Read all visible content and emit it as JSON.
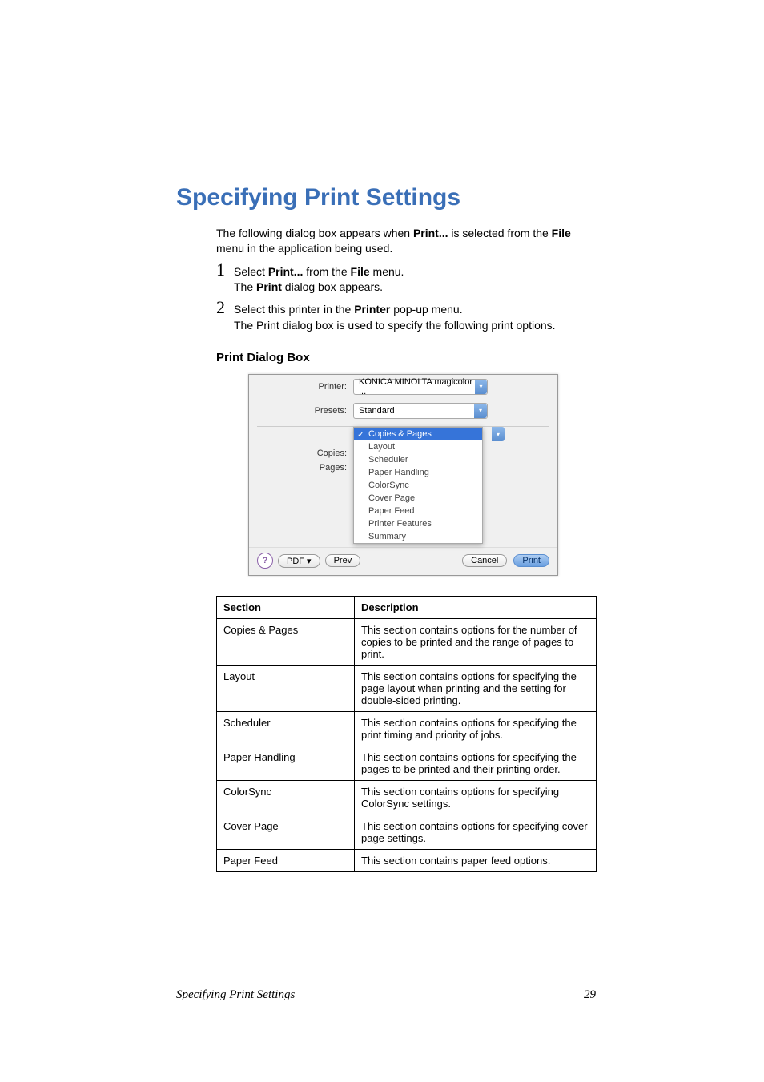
{
  "heading": "Specifying Print Settings",
  "intro": {
    "prefix": "The following dialog box appears when ",
    "bold1": "Print...",
    "mid": " is selected from the ",
    "bold2": "File",
    "suffix": " menu in the application being used."
  },
  "steps": [
    {
      "num": "1",
      "line1_pre": "Select ",
      "line1_b1": "Print...",
      "line1_mid": " from the ",
      "line1_b2": "File",
      "line1_post": " menu.",
      "line2_pre": "The ",
      "line2_b1": "Print",
      "line2_post": " dialog box appears."
    },
    {
      "num": "2",
      "line1_pre": "Select this printer in the ",
      "line1_b1": "Printer",
      "line1_post": " pop-up menu.",
      "line2": "The Print dialog box is used to specify the following print options."
    }
  ],
  "sub_heading": "Print Dialog Box",
  "dialog": {
    "printer_label": "Printer:",
    "printer_value": "KONICA MINOLTA magicolor ...",
    "presets_label": "Presets:",
    "presets_value": "Standard",
    "copies_label": "Copies:",
    "pages_label": "Pages:",
    "menu_items": [
      "Copies & Pages",
      "Layout",
      "Scheduler",
      "Paper Handling",
      "ColorSync",
      "Cover Page",
      "Paper Feed",
      "Printer Features",
      "Summary"
    ],
    "footer": {
      "help": "?",
      "pdf": "PDF ▾",
      "preview": "Prev",
      "cancel": "Cancel",
      "print": "Print"
    }
  },
  "table": {
    "headers": [
      "Section",
      "Description"
    ],
    "rows": [
      [
        "Copies & Pages",
        "This section contains options for the number of copies to be printed and the range of pages to print."
      ],
      [
        "Layout",
        "This section contains options for specifying the page layout when printing and the setting for double-sided printing."
      ],
      [
        "Scheduler",
        "This section contains options for specifying the print timing and priority of jobs."
      ],
      [
        "Paper Handling",
        "This section contains options for specifying the pages to be printed and their printing order."
      ],
      [
        "ColorSync",
        "This section contains options for specifying ColorSync settings."
      ],
      [
        "Cover Page",
        "This section contains options for specifying cover page settings."
      ],
      [
        "Paper Feed",
        "This section contains paper feed options."
      ]
    ]
  },
  "footer": {
    "text": "Specifying Print Settings",
    "page": "29"
  }
}
